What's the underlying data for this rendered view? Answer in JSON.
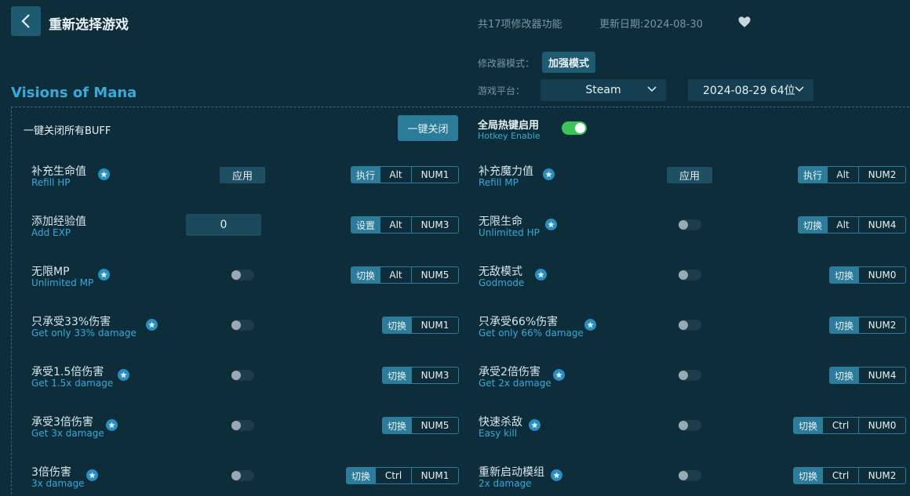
{
  "header": {
    "back_icon": "chevron-left-icon",
    "title": "重新选择游戏",
    "feature_count": "共17项修改器功能",
    "update_date": "更新日期:2024-08-30",
    "favorite_icon": "heart-icon"
  },
  "mode": {
    "label": "修改器模式：",
    "value": "加强模式"
  },
  "platform": {
    "label": "游戏平台：",
    "value": "Steam",
    "version": "2024-08-29 64位"
  },
  "game_title": "Visions of Mana",
  "global": {
    "all_off_label": "一键关闭所有BUFF",
    "all_off_button": "一键关闭",
    "hotkey_label": "全局热键启用",
    "hotkey_sub": "Hotkey Enable",
    "hotkey_enabled": true
  },
  "options": [
    {
      "cn": "补充生命值",
      "en": "Refill HP",
      "control": "apply",
      "control_label": "应用",
      "action": "执行",
      "keys": [
        "Alt",
        "NUM1"
      ]
    },
    {
      "cn": "补充魔力值",
      "en": "Refill MP",
      "control": "apply",
      "control_label": "应用",
      "action": "执行",
      "keys": [
        "Alt",
        "NUM2"
      ]
    },
    {
      "cn": "添加经验值",
      "en": "Add EXP",
      "control": "input",
      "value": "0",
      "action": "设置",
      "keys": [
        "Alt",
        "NUM3"
      ]
    },
    {
      "cn": "无限生命",
      "en": "Unlimited HP",
      "control": "toggle",
      "on": false,
      "action": "切换",
      "keys": [
        "Alt",
        "NUM4"
      ]
    },
    {
      "cn": "无限MP",
      "en": "Unlimited MP",
      "control": "toggle",
      "on": false,
      "action": "切换",
      "keys": [
        "Alt",
        "NUM5"
      ]
    },
    {
      "cn": "无敌模式",
      "en": "Godmode",
      "control": "toggle",
      "on": false,
      "action": "切换",
      "keys": [
        "NUM0"
      ]
    },
    {
      "cn": "只承受33%伤害",
      "en": "Get only 33% damage",
      "control": "toggle",
      "on": false,
      "action": "切换",
      "keys": [
        "NUM1"
      ]
    },
    {
      "cn": "只承受66%伤害",
      "en": "Get only 66% damage",
      "control": "toggle",
      "on": false,
      "action": "切换",
      "keys": [
        "NUM2"
      ]
    },
    {
      "cn": "承受1.5倍伤害",
      "en": "Get 1.5x damage",
      "control": "toggle",
      "on": false,
      "action": "切换",
      "keys": [
        "NUM3"
      ]
    },
    {
      "cn": "承受2倍伤害",
      "en": "Get 2x damage",
      "control": "toggle",
      "on": false,
      "action": "切换",
      "keys": [
        "NUM4"
      ]
    },
    {
      "cn": "承受3倍伤害",
      "en": "Get 3x damage",
      "control": "toggle",
      "on": false,
      "action": "切换",
      "keys": [
        "NUM5"
      ]
    },
    {
      "cn": "快速杀敌",
      "en": "Easy kill",
      "control": "toggle",
      "on": false,
      "action": "切换",
      "keys": [
        "Ctrl",
        "NUM0"
      ]
    },
    {
      "cn": "3倍伤害",
      "en": "3x damage",
      "control": "toggle",
      "on": false,
      "action": "切换",
      "keys": [
        "Ctrl",
        "NUM1"
      ]
    },
    {
      "cn": "重新启动模组",
      "en": "2x damage",
      "control": "toggle",
      "on": false,
      "action": "切换",
      "keys": [
        "Ctrl",
        "NUM2"
      ]
    }
  ],
  "colors": {
    "background": "#0e2d3b",
    "accent": "#39a9d8",
    "button": "#2a7c99",
    "toggle_on": "#3cc45a"
  }
}
